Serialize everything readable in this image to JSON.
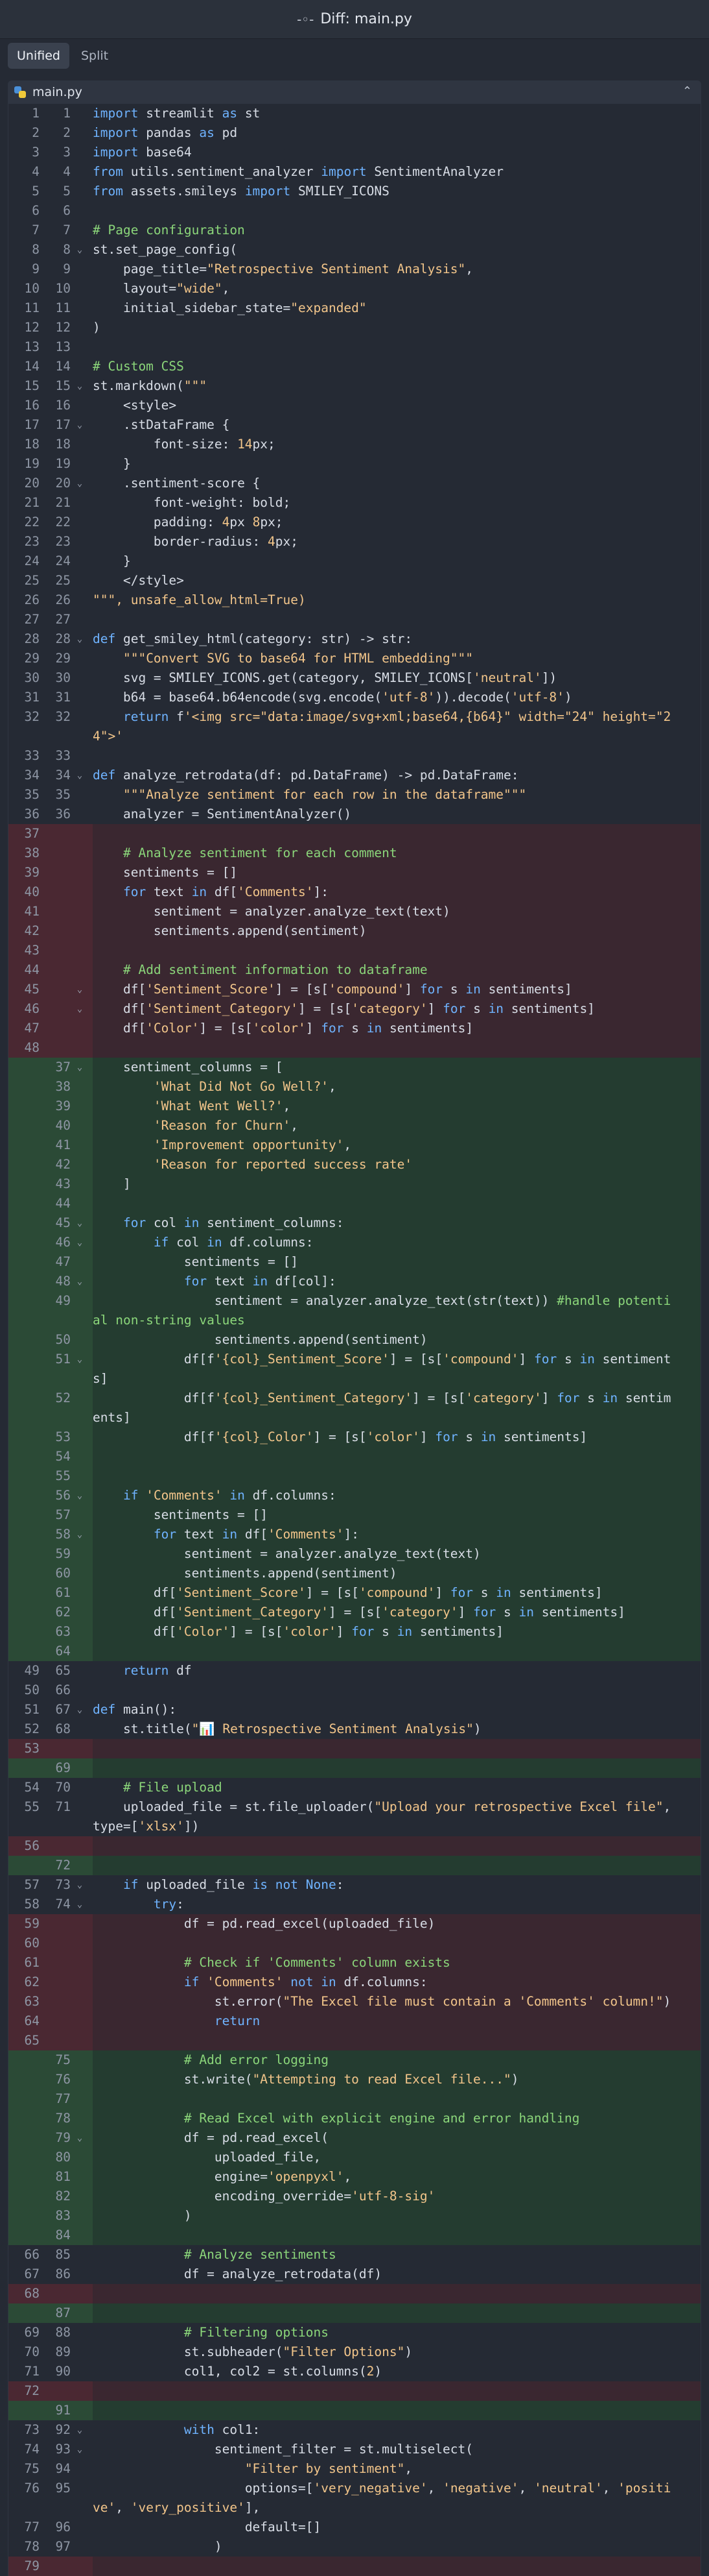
{
  "window": {
    "title": "Diff: main.py"
  },
  "toolbar": {
    "tabs": [
      {
        "label": "Unified"
      },
      {
        "label": "Split"
      }
    ]
  },
  "file": {
    "name": "main.py"
  },
  "rows": [
    {
      "o": "1",
      "n": "1",
      "t": "ctx",
      "c": "import streamlit as st"
    },
    {
      "o": "2",
      "n": "2",
      "t": "ctx",
      "c": "import pandas as pd"
    },
    {
      "o": "3",
      "n": "3",
      "t": "ctx",
      "c": "import base64"
    },
    {
      "o": "4",
      "n": "4",
      "t": "ctx",
      "c": "from utils.sentiment_analyzer import SentimentAnalyzer"
    },
    {
      "o": "5",
      "n": "5",
      "t": "ctx",
      "c": "from assets.smileys import SMILEY_ICONS"
    },
    {
      "o": "6",
      "n": "6",
      "t": "ctx",
      "c": ""
    },
    {
      "o": "7",
      "n": "7",
      "t": "ctx",
      "c": "# Page configuration"
    },
    {
      "o": "8",
      "n": "8",
      "t": "ctx",
      "c": "st.set_page_config("
    },
    {
      "o": "9",
      "n": "9",
      "t": "ctx",
      "c": "    page_title=\"Retrospective Sentiment Analysis\","
    },
    {
      "o": "10",
      "n": "10",
      "t": "ctx",
      "c": "    layout=\"wide\","
    },
    {
      "o": "11",
      "n": "11",
      "t": "ctx",
      "c": "    initial_sidebar_state=\"expanded\""
    },
    {
      "o": "12",
      "n": "12",
      "t": "ctx",
      "c": ")"
    },
    {
      "o": "13",
      "n": "13",
      "t": "ctx",
      "c": ""
    },
    {
      "o": "14",
      "n": "14",
      "t": "ctx",
      "c": "# Custom CSS"
    },
    {
      "o": "15",
      "n": "15",
      "t": "ctx",
      "c": "st.markdown(\"\"\""
    },
    {
      "o": "16",
      "n": "16",
      "t": "ctx",
      "c": "    <style>"
    },
    {
      "o": "17",
      "n": "17",
      "t": "ctx",
      "c": "    .stDataFrame {"
    },
    {
      "o": "18",
      "n": "18",
      "t": "ctx",
      "c": "        font-size: 14px;"
    },
    {
      "o": "19",
      "n": "19",
      "t": "ctx",
      "c": "    }"
    },
    {
      "o": "20",
      "n": "20",
      "t": "ctx",
      "c": "    .sentiment-score {"
    },
    {
      "o": "21",
      "n": "21",
      "t": "ctx",
      "c": "        font-weight: bold;"
    },
    {
      "o": "22",
      "n": "22",
      "t": "ctx",
      "c": "        padding: 4px 8px;"
    },
    {
      "o": "23",
      "n": "23",
      "t": "ctx",
      "c": "        border-radius: 4px;"
    },
    {
      "o": "24",
      "n": "24",
      "t": "ctx",
      "c": "    }"
    },
    {
      "o": "25",
      "n": "25",
      "t": "ctx",
      "c": "    </style>"
    },
    {
      "o": "26",
      "n": "26",
      "t": "ctx",
      "c": "\"\"\", unsafe_allow_html=True)"
    },
    {
      "o": "27",
      "n": "27",
      "t": "ctx",
      "c": ""
    },
    {
      "o": "28",
      "n": "28",
      "t": "ctx",
      "c": "def get_smiley_html(category: str) -> str:"
    },
    {
      "o": "29",
      "n": "29",
      "t": "ctx",
      "c": "    \"\"\"Convert SVG to base64 for HTML embedding\"\"\""
    },
    {
      "o": "30",
      "n": "30",
      "t": "ctx",
      "c": "    svg = SMILEY_ICONS.get(category, SMILEY_ICONS['neutral'])"
    },
    {
      "o": "31",
      "n": "31",
      "t": "ctx",
      "c": "    b64 = base64.b64encode(svg.encode('utf-8')).decode('utf-8')"
    },
    {
      "o": "32",
      "n": "32",
      "t": "ctx",
      "c": "    return f'<img src=\"data:image/svg+xml;base64,{b64}\" width=\"24\" height=\"24\">'"
    },
    {
      "o": "33",
      "n": "33",
      "t": "ctx",
      "c": ""
    },
    {
      "o": "34",
      "n": "34",
      "t": "ctx",
      "c": "def analyze_retrodata(df: pd.DataFrame) -> pd.DataFrame:"
    },
    {
      "o": "35",
      "n": "35",
      "t": "ctx",
      "c": "    \"\"\"Analyze sentiment for each row in the dataframe\"\"\""
    },
    {
      "o": "36",
      "n": "36",
      "t": "ctx",
      "c": "    analyzer = SentimentAnalyzer()"
    },
    {
      "o": "37",
      "n": "",
      "t": "del",
      "c": ""
    },
    {
      "o": "38",
      "n": "",
      "t": "del",
      "c": "    # Analyze sentiment for each comment"
    },
    {
      "o": "39",
      "n": "",
      "t": "del",
      "c": "    sentiments = []"
    },
    {
      "o": "40",
      "n": "",
      "t": "del",
      "c": "    for text in df['Comments']:"
    },
    {
      "o": "41",
      "n": "",
      "t": "del",
      "c": "        sentiment = analyzer.analyze_text(text)"
    },
    {
      "o": "42",
      "n": "",
      "t": "del",
      "c": "        sentiments.append(sentiment)"
    },
    {
      "o": "43",
      "n": "",
      "t": "del",
      "c": ""
    },
    {
      "o": "44",
      "n": "",
      "t": "del",
      "c": "    # Add sentiment information to dataframe"
    },
    {
      "o": "45",
      "n": "",
      "t": "del",
      "c": "    df['Sentiment_Score'] = [s['compound'] for s in sentiments]"
    },
    {
      "o": "46",
      "n": "",
      "t": "del",
      "c": "    df['Sentiment_Category'] = [s['category'] for s in sentiments]"
    },
    {
      "o": "47",
      "n": "",
      "t": "del",
      "c": "    df['Color'] = [s['color'] for s in sentiments]"
    },
    {
      "o": "48",
      "n": "",
      "t": "del",
      "c": ""
    },
    {
      "o": "",
      "n": "37",
      "t": "add",
      "c": "    sentiment_columns = ["
    },
    {
      "o": "",
      "n": "38",
      "t": "add",
      "c": "        'What Did Not Go Well?',"
    },
    {
      "o": "",
      "n": "39",
      "t": "add",
      "c": "        'What Went Well?',"
    },
    {
      "o": "",
      "n": "40",
      "t": "add",
      "c": "        'Reason for Churn',"
    },
    {
      "o": "",
      "n": "41",
      "t": "add",
      "c": "        'Improvement opportunity',"
    },
    {
      "o": "",
      "n": "42",
      "t": "add",
      "c": "        'Reason for reported success rate'"
    },
    {
      "o": "",
      "n": "43",
      "t": "add",
      "c": "    ]"
    },
    {
      "o": "",
      "n": "44",
      "t": "add",
      "c": ""
    },
    {
      "o": "",
      "n": "45",
      "t": "add",
      "c": "    for col in sentiment_columns:"
    },
    {
      "o": "",
      "n": "46",
      "t": "add",
      "c": "        if col in df.columns:"
    },
    {
      "o": "",
      "n": "47",
      "t": "add",
      "c": "            sentiments = []"
    },
    {
      "o": "",
      "n": "48",
      "t": "add",
      "c": "            for text in df[col]:"
    },
    {
      "o": "",
      "n": "49",
      "t": "add",
      "c": "                sentiment = analyzer.analyze_text(str(text)) #handle potential non-string values"
    },
    {
      "o": "",
      "n": "50",
      "t": "add",
      "c": "                sentiments.append(sentiment)"
    },
    {
      "o": "",
      "n": "51",
      "t": "add",
      "c": "            df[f'{col}_Sentiment_Score'] = [s['compound'] for s in sentiments]"
    },
    {
      "o": "",
      "n": "52",
      "t": "add",
      "c": "            df[f'{col}_Sentiment_Category'] = [s['category'] for s in sentiments]"
    },
    {
      "o": "",
      "n": "53",
      "t": "add",
      "c": "            df[f'{col}_Color'] = [s['color'] for s in sentiments]"
    },
    {
      "o": "",
      "n": "54",
      "t": "add",
      "c": ""
    },
    {
      "o": "",
      "n": "55",
      "t": "add",
      "c": ""
    },
    {
      "o": "",
      "n": "56",
      "t": "add",
      "c": "    if 'Comments' in df.columns:"
    },
    {
      "o": "",
      "n": "57",
      "t": "add",
      "c": "        sentiments = []"
    },
    {
      "o": "",
      "n": "58",
      "t": "add",
      "c": "        for text in df['Comments']:"
    },
    {
      "o": "",
      "n": "59",
      "t": "add",
      "c": "            sentiment = analyzer.analyze_text(text)"
    },
    {
      "o": "",
      "n": "60",
      "t": "add",
      "c": "            sentiments.append(sentiment)"
    },
    {
      "o": "",
      "n": "61",
      "t": "add",
      "c": "        df['Sentiment_Score'] = [s['compound'] for s in sentiments]"
    },
    {
      "o": "",
      "n": "62",
      "t": "add",
      "c": "        df['Sentiment_Category'] = [s['category'] for s in sentiments]"
    },
    {
      "o": "",
      "n": "63",
      "t": "add",
      "c": "        df['Color'] = [s['color'] for s in sentiments]"
    },
    {
      "o": "",
      "n": "64",
      "t": "add",
      "c": ""
    },
    {
      "o": "49",
      "n": "65",
      "t": "ctx",
      "c": "    return df"
    },
    {
      "o": "50",
      "n": "66",
      "t": "ctx",
      "c": ""
    },
    {
      "o": "51",
      "n": "67",
      "t": "ctx",
      "c": "def main():"
    },
    {
      "o": "52",
      "n": "68",
      "t": "ctx",
      "c": "    st.title(\"📊 Retrospective Sentiment Analysis\")"
    },
    {
      "o": "53",
      "n": "",
      "t": "del",
      "c": ""
    },
    {
      "o": "",
      "n": "69",
      "t": "add",
      "c": ""
    },
    {
      "o": "54",
      "n": "70",
      "t": "ctx",
      "c": "    # File upload"
    },
    {
      "o": "55",
      "n": "71",
      "t": "ctx",
      "c": "    uploaded_file = st.file_uploader(\"Upload your retrospective Excel file\", type=['xlsx'])"
    },
    {
      "o": "56",
      "n": "",
      "t": "del",
      "c": ""
    },
    {
      "o": "",
      "n": "72",
      "t": "add",
      "c": ""
    },
    {
      "o": "57",
      "n": "73",
      "t": "ctx",
      "c": "    if uploaded_file is not None:"
    },
    {
      "o": "58",
      "n": "74",
      "t": "ctx",
      "c": "        try:"
    },
    {
      "o": "59",
      "n": "",
      "t": "del",
      "c": "            df = pd.read_excel(uploaded_file)"
    },
    {
      "o": "60",
      "n": "",
      "t": "del",
      "c": ""
    },
    {
      "o": "61",
      "n": "",
      "t": "del",
      "c": "            # Check if 'Comments' column exists"
    },
    {
      "o": "62",
      "n": "",
      "t": "del",
      "c": "            if 'Comments' not in df.columns:"
    },
    {
      "o": "63",
      "n": "",
      "t": "del",
      "c": "                st.error(\"The Excel file must contain a 'Comments' column!\")"
    },
    {
      "o": "64",
      "n": "",
      "t": "del",
      "c": "                return"
    },
    {
      "o": "65",
      "n": "",
      "t": "del",
      "c": ""
    },
    {
      "o": "",
      "n": "75",
      "t": "add",
      "c": "            # Add error logging"
    },
    {
      "o": "",
      "n": "76",
      "t": "add",
      "c": "            st.write(\"Attempting to read Excel file...\")"
    },
    {
      "o": "",
      "n": "77",
      "t": "add",
      "c": ""
    },
    {
      "o": "",
      "n": "78",
      "t": "add",
      "c": "            # Read Excel with explicit engine and error handling"
    },
    {
      "o": "",
      "n": "79",
      "t": "add",
      "c": "            df = pd.read_excel("
    },
    {
      "o": "",
      "n": "80",
      "t": "add",
      "c": "                uploaded_file,"
    },
    {
      "o": "",
      "n": "81",
      "t": "add",
      "c": "                engine='openpyxl',"
    },
    {
      "o": "",
      "n": "82",
      "t": "add",
      "c": "                encoding_override='utf-8-sig'"
    },
    {
      "o": "",
      "n": "83",
      "t": "add",
      "c": "            )"
    },
    {
      "o": "",
      "n": "84",
      "t": "add",
      "c": ""
    },
    {
      "o": "66",
      "n": "85",
      "t": "ctx",
      "c": "            # Analyze sentiments"
    },
    {
      "o": "67",
      "n": "86",
      "t": "ctx",
      "c": "            df = analyze_retrodata(df)"
    },
    {
      "o": "68",
      "n": "",
      "t": "del",
      "c": ""
    },
    {
      "o": "",
      "n": "87",
      "t": "add",
      "c": ""
    },
    {
      "o": "69",
      "n": "88",
      "t": "ctx",
      "c": "            # Filtering options"
    },
    {
      "o": "70",
      "n": "89",
      "t": "ctx",
      "c": "            st.subheader(\"Filter Options\")"
    },
    {
      "o": "71",
      "n": "90",
      "t": "ctx",
      "c": "            col1, col2 = st.columns(2)"
    },
    {
      "o": "72",
      "n": "",
      "t": "del",
      "c": ""
    },
    {
      "o": "",
      "n": "91",
      "t": "add",
      "c": ""
    },
    {
      "o": "73",
      "n": "92",
      "t": "ctx",
      "c": "            with col1:"
    },
    {
      "o": "74",
      "n": "93",
      "t": "ctx",
      "c": "                sentiment_filter = st.multiselect("
    },
    {
      "o": "75",
      "n": "94",
      "t": "ctx",
      "c": "                    \"Filter by sentiment\","
    },
    {
      "o": "76",
      "n": "95",
      "t": "ctx",
      "c": "                    options=['very_negative', 'negative', 'neutral', 'positive', 'very_positive'],"
    },
    {
      "o": "77",
      "n": "96",
      "t": "ctx",
      "c": "                    default=[]"
    },
    {
      "o": "78",
      "n": "97",
      "t": "ctx",
      "c": "                )"
    },
    {
      "o": "79",
      "n": "",
      "t": "del",
      "c": ""
    }
  ]
}
